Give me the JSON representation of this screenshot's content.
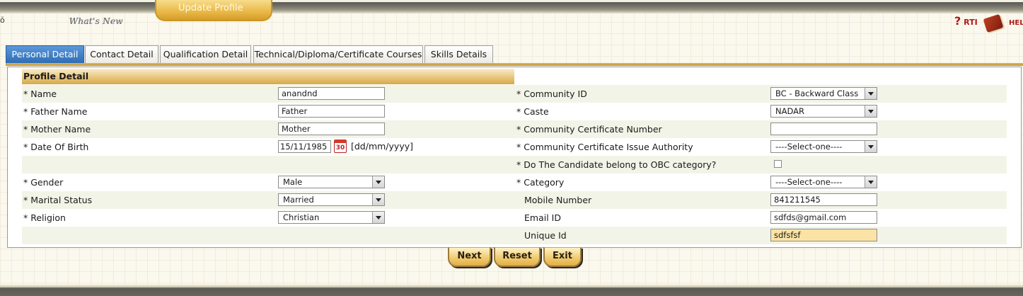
{
  "header": {
    "update_profile": "Update Profile",
    "whats_new": "What's New",
    "left_glyph": "ŏ",
    "rti_q": "?",
    "rti": "RTI",
    "help": "HEL"
  },
  "tabs": [
    {
      "label": "Personal Detail",
      "active": true
    },
    {
      "label": "Contact Detail"
    },
    {
      "label": "Qualification Detail"
    },
    {
      "label": "Technical/Diploma/Certificate Courses"
    },
    {
      "label": "Skills Details"
    }
  ],
  "section_title": "Profile Detail",
  "left": {
    "name_label": "* Name",
    "name_value": "anandnd",
    "father_label": "* Father Name",
    "father_value": "Father",
    "mother_label": "* Mother Name",
    "mother_value": "Mother",
    "dob_label": "* Date Of Birth",
    "dob_value": "15/11/1985",
    "dob_format": "[dd/mm/yyyy]",
    "cal_day": "30",
    "gender_label": "* Gender",
    "gender_value": "Male",
    "marital_label": "* Marital Status",
    "marital_value": "Married",
    "religion_label": "* Religion",
    "religion_value": "Christian"
  },
  "right": {
    "community_label": "* Community ID",
    "community_value": "BC - Backward Class",
    "caste_label": "* Caste",
    "caste_value": "NADAR",
    "cert_no_label": "* Community Certificate Number",
    "cert_no_value": "",
    "cert_auth_label": "* Community Certificate Issue Authority",
    "cert_auth_value": "----Select-one----",
    "obc_label": "* Do The Candidate belong to OBC category?",
    "category_label": "* Category",
    "category_value": "----Select-one----",
    "mobile_label": "Mobile Number",
    "mobile_value": "841211545",
    "email_label": "Email ID",
    "email_value": "sdfds@gmail.com",
    "unique_label": "Unique Id",
    "unique_value": "sdfsfsf"
  },
  "buttons": {
    "next": "Next",
    "reset": "Reset",
    "exit": "Exit"
  }
}
